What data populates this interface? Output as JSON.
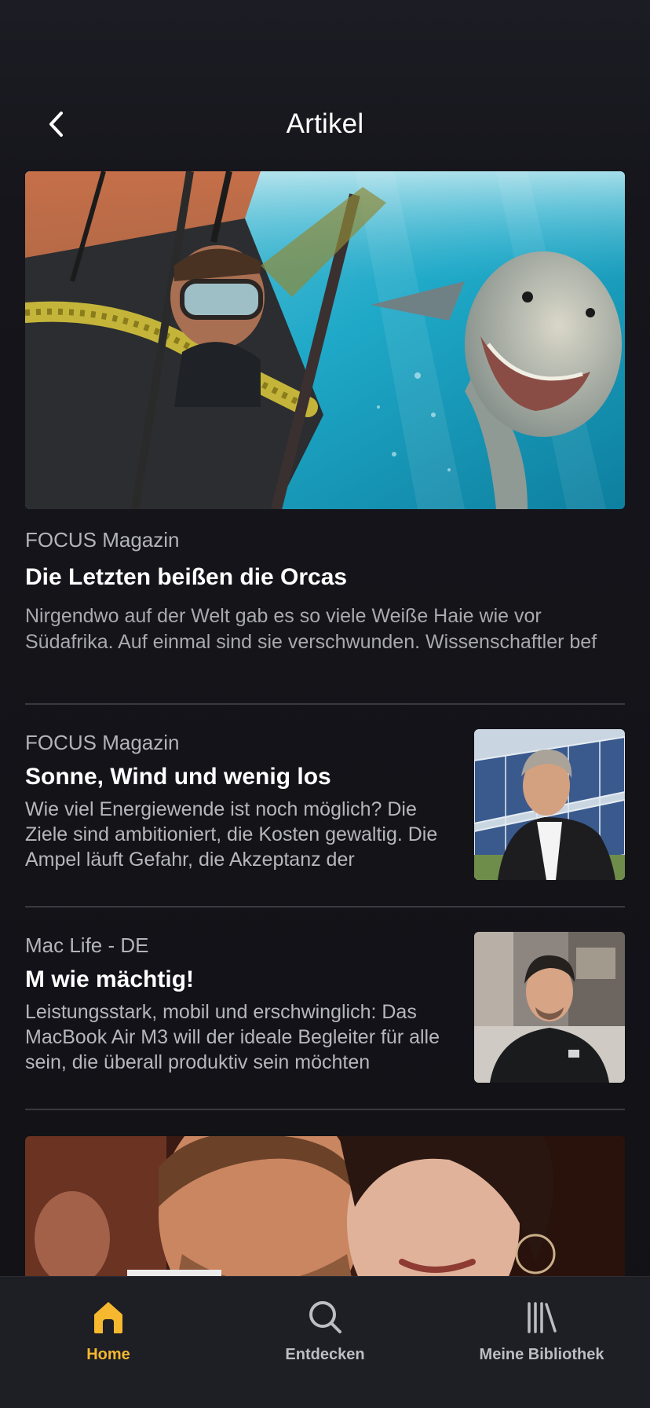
{
  "header": {
    "title": "Artikel"
  },
  "featured": {
    "source": "FOCUS Magazin",
    "title": "Die Letzten beißen die Orcas",
    "description": "Nirgendwo auf der Welt gab es so viele Weiße Haie wie vor\nSüdafrika. Auf einmal sind sie verschwunden. Wissenschaftler bef"
  },
  "articles": [
    {
      "source": "FOCUS Magazin",
      "title": "Sonne, Wind und wenig los",
      "description": "Wie viel Energiewende ist noch möglich? Die Ziele sind ambitioniert, die Kosten gewaltig. Die Ampel läuft Gefahr, die Akzeptanz der"
    },
    {
      "source": "Mac Life - DE",
      "title": "M wie mächtig!",
      "description": "Leistungsstark, mobil und erschwinglich: Das MacBook Air M3 will der ideale Begleiter für alle sein, die überall produktiv sein möchten"
    }
  ],
  "tabbar": {
    "tabs": [
      {
        "label": "Home",
        "icon": "home-icon",
        "active": true
      },
      {
        "label": "Entdecken",
        "icon": "search-icon",
        "active": false
      },
      {
        "label": "Meine Bibliothek",
        "icon": "library-icon",
        "active": false
      }
    ]
  },
  "colors": {
    "accent": "#f5b82e",
    "background": "#131318",
    "tabbar": "#1e1e25"
  }
}
